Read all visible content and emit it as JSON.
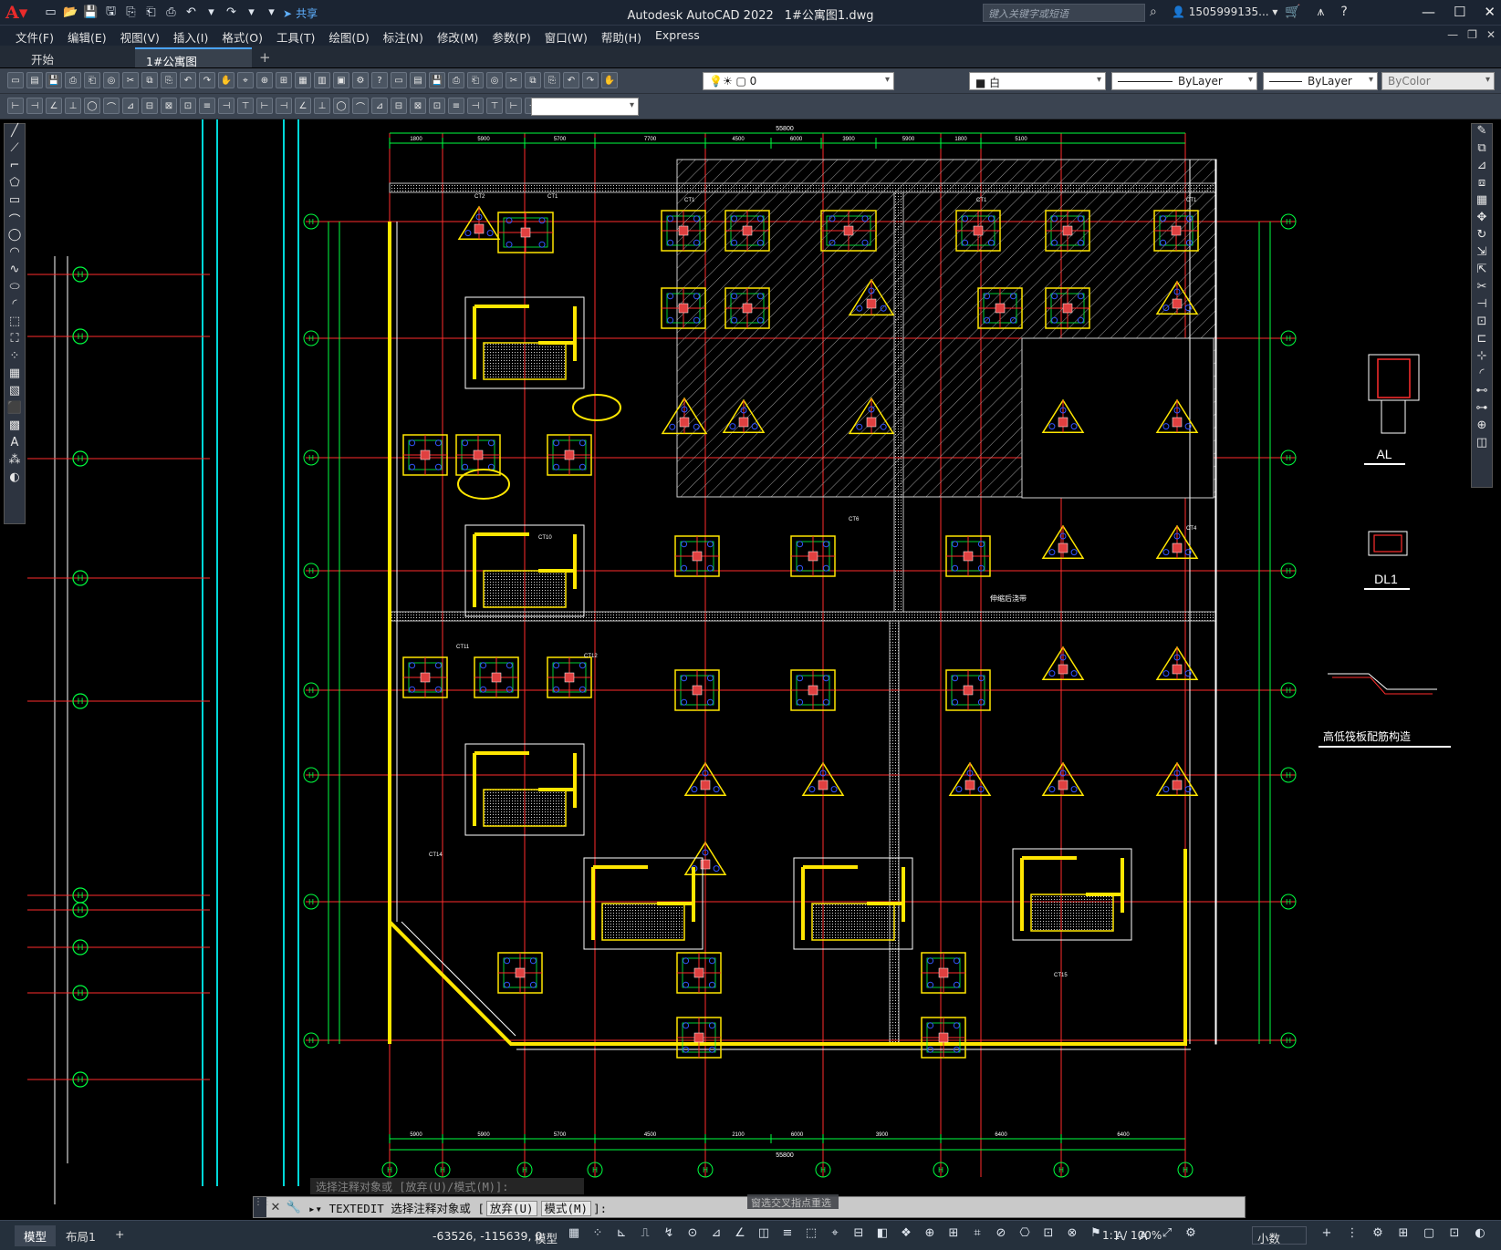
{
  "app": {
    "name": "Autodesk AutoCAD 2022",
    "file": "1#公寓图1.dwg",
    "share_label": "共享",
    "search_placeholder": "键入关键字或短语",
    "user": "1505999135...",
    "colors": {
      "accent": "#4aa3ff",
      "logo": "#ea2b2b",
      "titlebar": "#1b2432",
      "canvas": "#000000"
    }
  },
  "menu": [
    "文件(F)",
    "编辑(E)",
    "视图(V)",
    "插入(I)",
    "格式(O)",
    "工具(T)",
    "绘图(D)",
    "标注(N)",
    "修改(M)",
    "参数(P)",
    "窗口(W)",
    "帮助(H)",
    "Express"
  ],
  "tabs": [
    {
      "label": "开始"
    },
    {
      "label": "1#公寓图1*",
      "active": true
    }
  ],
  "toolbar": {
    "layer_value": "0",
    "color_value": "白",
    "linetype_value": "ByLayer",
    "lineweight_value": "ByLayer",
    "plotstyle_value": "ByColor",
    "style_value": ""
  },
  "drawing": {
    "details": [
      {
        "label": "AL"
      },
      {
        "label": "DL1"
      },
      {
        "label": "高低筏板配筋构造"
      }
    ],
    "annotations": [
      "伸缩后浇带",
      "CT1",
      "CT2",
      "CT4",
      "CT6",
      "CT10",
      "CT11",
      "CT12",
      "CT14",
      "CT15"
    ],
    "grid_label": "H",
    "top_dims": [
      "1800",
      "5900",
      "5700",
      "7700",
      "4500",
      "6000",
      "3900",
      "5900",
      "1800",
      "5100"
    ],
    "bottom_dims": [
      "5900",
      "5900",
      "5700",
      "4500",
      "2100",
      "6000",
      "3900",
      "6400",
      "6400"
    ],
    "overall_dim": "55800"
  },
  "command": {
    "history": "选择注释对象或 [放弃(U)/模式(M)]:",
    "name": "TEXTEDIT",
    "prompt": "选择注释对象或",
    "opt1": "放弃(U)",
    "opt2": "模式(M)",
    "tail": "]:",
    "tooltip": "窗选交叉指点重选"
  },
  "status": {
    "layout_tabs": [
      "模型",
      "布局1"
    ],
    "coords": "-63526, -115639, 0",
    "mode": "模型",
    "scale": "1:1 / 100%",
    "units": "小数"
  }
}
